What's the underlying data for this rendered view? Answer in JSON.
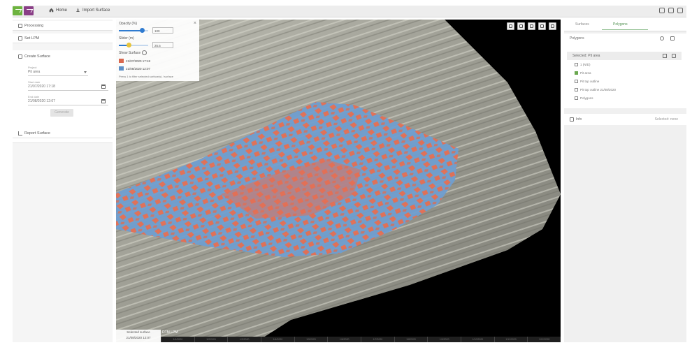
{
  "topbar": {
    "nav": [
      {
        "label": "Home",
        "icon": "home-icon"
      },
      {
        "label": "Import Surface",
        "icon": "import-icon"
      }
    ],
    "icons": [
      "settings-icon",
      "help-icon",
      "user-icon"
    ]
  },
  "left": {
    "rows": [
      {
        "label": "Processing",
        "icon": "gear-icon"
      },
      {
        "label": "Set LPM",
        "icon": "layers-icon"
      }
    ],
    "section_title": "Create Surface",
    "fields": [
      {
        "label": "Project",
        "value": "Pit area"
      },
      {
        "label": "Start date",
        "value": "21/07/2020 17:18"
      },
      {
        "label": "End date",
        "value": "21/08/2020 12:07"
      }
    ],
    "generate_label": "Generate",
    "report_label": "Report Surface"
  },
  "control": {
    "opacity_label": "Opacity (%)",
    "opacity_value": "100",
    "opacity_fraction": 0.8,
    "slider2_label": "Slider (m)",
    "slider2_value": "25.5",
    "slider2_fraction": 0.35,
    "show_surface_label": "Show Surface",
    "legend": [
      {
        "label": "21/07/2020 17:18",
        "color": "#d9684f"
      },
      {
        "label": "21/08/2020 12:07",
        "color": "#5d8fc7"
      }
    ],
    "note": "Press 1 to filter selected surface(s) / surface"
  },
  "viewport": {
    "tools": [
      "home-view-icon",
      "rotate-icon",
      "measure-icon",
      "camera-icon",
      "fullscreen-icon"
    ],
    "bottom_info": {
      "title": "Selected surface",
      "date": "21/08/2020 12:07"
    },
    "timeline_label": "DTM LPM",
    "timeline_ticks": [
      "1/1/2020",
      "1/2/2020",
      "1/3/2020",
      "1/4/2020",
      "1/5/2020",
      "1/6/2020",
      "1/7/2020",
      "1/8/2020",
      "1/9/2020",
      "1/10/2020",
      "1/11/2020",
      "1/12/2020"
    ],
    "colors": {
      "dark": "#000000",
      "terrain": "#9b9b90",
      "fill": "#e36f55",
      "cut": "#6f9ecf"
    }
  },
  "right": {
    "tabs": [
      {
        "label": "Surfaces",
        "active": false
      },
      {
        "label": "Polygons",
        "active": true
      }
    ],
    "sub_title": "Polygons",
    "header": "Selected: Pit area",
    "items": [
      {
        "label": "1 (N/D)",
        "checked": false
      },
      {
        "label": "Pit area",
        "checked": true
      },
      {
        "label": "Pit top outline",
        "checked": false
      },
      {
        "label": "Pit top outline 21/08/2020",
        "checked": false
      },
      {
        "label": "Polygons",
        "checked": false
      }
    ],
    "card2_title": "Info",
    "card2_right": "Selected: none"
  }
}
